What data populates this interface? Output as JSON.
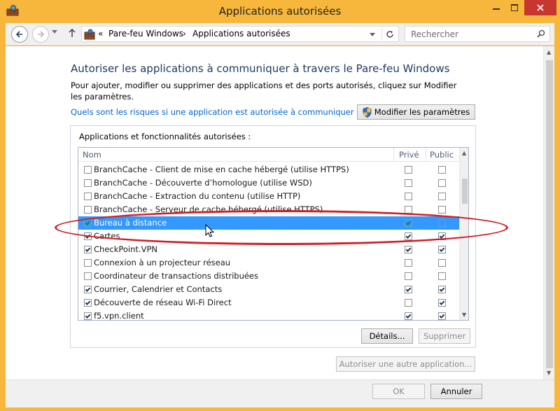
{
  "window": {
    "title": "Applications autorisées",
    "frame_color": "#f6b73c",
    "close_color": "#c7372f"
  },
  "navbar": {
    "back_icon": "back-arrow-icon",
    "forward_icon": "forward-arrow-icon",
    "up_icon": "up-arrow-icon",
    "address": {
      "prefix": "«",
      "breadcrumb": [
        "Pare-feu Windows",
        "Applications autorisées"
      ],
      "separator": "›"
    },
    "search_placeholder": "Rechercher"
  },
  "content": {
    "heading": "Autoriser les applications à communiquer à travers le Pare-feu Windows",
    "description": "Pour ajouter, modifier ou supprimer des applications et des ports autorisés, cliquez sur Modifier les paramètres.",
    "risk_link": "Quels sont les risques si une application est autorisée à communiquer ?",
    "modify_button": "Modifier les paramètres",
    "heading_color": "#1e395b",
    "link_color": "#0066cc"
  },
  "apps_group": {
    "label": "Applications et fonctionnalités autorisées :",
    "columns": [
      "Nom",
      "Privé",
      "Public"
    ],
    "rows": [
      {
        "name": "BranchCache - Client de mise en cache hébergé (utilise HTTPS)",
        "enabled": false,
        "private": false,
        "public": false,
        "selected": false
      },
      {
        "name": "BranchCache - Découverte d’homologue (utilise WSD)",
        "enabled": false,
        "private": false,
        "public": false,
        "selected": false
      },
      {
        "name": "BranchCache - Extraction du contenu (utilise HTTP)",
        "enabled": false,
        "private": false,
        "public": false,
        "selected": false
      },
      {
        "name": "BranchCache - Serveur de cache hébergé (utilise HTTPS)",
        "enabled": false,
        "private": false,
        "public": false,
        "selected": false
      },
      {
        "name": "Bureau à distance",
        "enabled": true,
        "private": true,
        "public": false,
        "selected": true
      },
      {
        "name": "Cartes",
        "enabled": true,
        "private": true,
        "public": true,
        "selected": false
      },
      {
        "name": "CheckPoint.VPN",
        "enabled": true,
        "private": true,
        "public": true,
        "selected": false
      },
      {
        "name": "Connexion à un projecteur réseau",
        "enabled": false,
        "private": false,
        "public": false,
        "selected": false
      },
      {
        "name": "Coordinateur de transactions distribuées",
        "enabled": false,
        "private": false,
        "public": false,
        "selected": false
      },
      {
        "name": "Courrier, Calendrier et Contacts",
        "enabled": true,
        "private": true,
        "public": true,
        "selected": false
      },
      {
        "name": "Découverte de réseau Wi-Fi Direct",
        "enabled": true,
        "private": false,
        "public": true,
        "selected": false
      },
      {
        "name": "f5.vpn.client",
        "enabled": true,
        "private": true,
        "public": true,
        "selected": false
      }
    ],
    "details_button": "Détails...",
    "remove_button": "Supprimer",
    "selection_color": "#3399ff"
  },
  "allow_other_button": "Autoriser une autre application...",
  "footer": {
    "ok_button": "OK",
    "cancel_button": "Annuler"
  },
  "annotation": {
    "shape": "ellipse",
    "color": "#d21f26",
    "highlights": "Bureau à distance"
  }
}
